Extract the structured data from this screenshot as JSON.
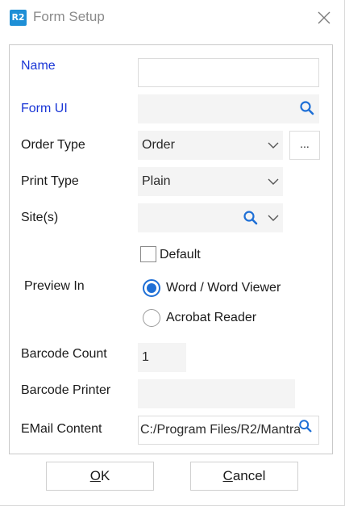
{
  "window": {
    "icon_text": "R2",
    "title": "Form Setup"
  },
  "form": {
    "name": {
      "label": "Name",
      "value": ""
    },
    "form_ui": {
      "label": "Form UI",
      "value": ""
    },
    "order_type": {
      "label": "Order Type",
      "value": "Order",
      "more_label": "..."
    },
    "print_type": {
      "label": "Print Type",
      "value": "Plain"
    },
    "sites": {
      "label": "Site(s)",
      "value": ""
    },
    "default": {
      "label": "Default",
      "checked": false
    },
    "preview_in": {
      "label": "Preview In",
      "options": [
        {
          "label": "Word / Word Viewer",
          "selected": true
        },
        {
          "label": "Acrobat Reader",
          "selected": false
        }
      ]
    },
    "barcode_count": {
      "label": "Barcode Count",
      "value": "1"
    },
    "barcode_printer": {
      "label": "Barcode Printer",
      "value": ""
    },
    "email_content": {
      "label": "EMail Content",
      "value": "C:/Program Files/R2/Mantra"
    }
  },
  "buttons": {
    "ok": {
      "mnemonic": "O",
      "rest": "K"
    },
    "cancel": {
      "mnemonic": "C",
      "rest": "ancel"
    }
  },
  "colors": {
    "accent": "#1e6fd6",
    "required_label": "#1a36d6",
    "app_icon": "#1e8fd6"
  }
}
